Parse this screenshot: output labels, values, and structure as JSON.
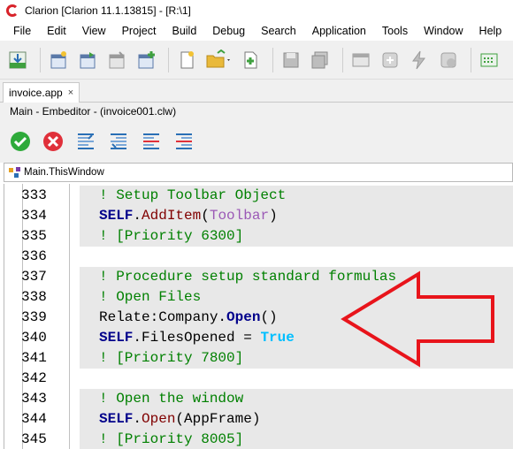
{
  "window": {
    "title": "Clarion [Clarion 11.1.13815] - [R:\\1]"
  },
  "menu": [
    "File",
    "Edit",
    "View",
    "Project",
    "Build",
    "Debug",
    "Search",
    "Application",
    "Tools",
    "Window",
    "Help"
  ],
  "tab": {
    "label": "invoice.app",
    "close": "×"
  },
  "embed_title": "Main - Embeditor - (invoice001.clw)",
  "breadcrumb": "Main.ThisWindow",
  "colors": {
    "comment": "#008000",
    "keyword": "#00008b",
    "arrow": "#e8141b"
  },
  "code_lines": [
    {
      "num": "333",
      "shaded": true,
      "tokens": [
        {
          "t": "! Setup Toolbar Object",
          "c": "cmt"
        }
      ]
    },
    {
      "num": "334",
      "shaded": true,
      "tokens": [
        {
          "t": "SELF",
          "c": "kw"
        },
        {
          "t": ".",
          "c": "plain"
        },
        {
          "t": "AddItem",
          "c": "fn"
        },
        {
          "t": "(",
          "c": "plain"
        },
        {
          "t": "Toolbar",
          "c": "tbl"
        },
        {
          "t": ")",
          "c": "plain"
        }
      ]
    },
    {
      "num": "335",
      "shaded": true,
      "tokens": [
        {
          "t": "! [Priority 6300]",
          "c": "cmt"
        }
      ]
    },
    {
      "num": "336",
      "shaded": false,
      "tokens": []
    },
    {
      "num": "337",
      "shaded": true,
      "tokens": [
        {
          "t": "! Procedure setup standard formulas",
          "c": "cmt"
        }
      ]
    },
    {
      "num": "338",
      "shaded": true,
      "tokens": [
        {
          "t": "! Open Files",
          "c": "cmt"
        }
      ]
    },
    {
      "num": "339",
      "shaded": true,
      "tokens": [
        {
          "t": "Relate:Company",
          "c": "plain"
        },
        {
          "t": ".",
          "c": "plain"
        },
        {
          "t": "Open",
          "c": "kw"
        },
        {
          "t": "()",
          "c": "plain"
        }
      ]
    },
    {
      "num": "340",
      "shaded": true,
      "tokens": [
        {
          "t": "SELF",
          "c": "kw"
        },
        {
          "t": ".",
          "c": "plain"
        },
        {
          "t": "FilesOpened",
          "c": "plain"
        },
        {
          "t": " = ",
          "c": "plain"
        },
        {
          "t": "True",
          "c": "true"
        }
      ]
    },
    {
      "num": "341",
      "shaded": true,
      "tokens": [
        {
          "t": "! [Priority 7800]",
          "c": "cmt"
        }
      ]
    },
    {
      "num": "342",
      "shaded": false,
      "tokens": []
    },
    {
      "num": "343",
      "shaded": true,
      "tokens": [
        {
          "t": "! Open the window",
          "c": "cmt"
        }
      ]
    },
    {
      "num": "344",
      "shaded": true,
      "tokens": [
        {
          "t": "SELF",
          "c": "kw"
        },
        {
          "t": ".",
          "c": "plain"
        },
        {
          "t": "Open",
          "c": "fn"
        },
        {
          "t": "(",
          "c": "plain"
        },
        {
          "t": "AppFrame",
          "c": "plain"
        },
        {
          "t": ")",
          "c": "plain"
        }
      ]
    },
    {
      "num": "345",
      "shaded": true,
      "tokens": [
        {
          "t": "! [Priority 8005]",
          "c": "cmt"
        }
      ]
    }
  ]
}
